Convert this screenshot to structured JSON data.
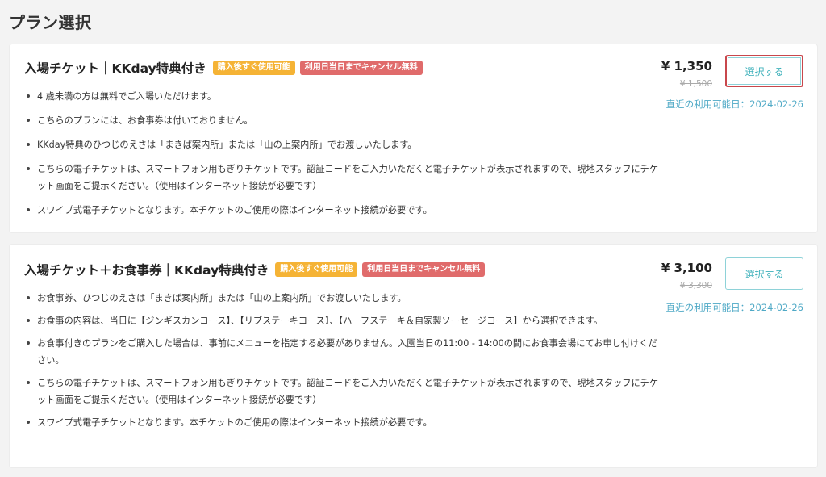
{
  "page": {
    "title": "プラン選択"
  },
  "plans": [
    {
      "name": "入場チケット｜KKday特典付き",
      "tags": [
        "購入後すぐ使用可能",
        "利用日当日までキャンセル無料"
      ],
      "price": "¥ 1,350",
      "original_price": "¥ 1,500",
      "availability": "直近の利用可能日：2024-02-26",
      "select_label": "選択する",
      "features": [
        "4 歳未満の方は無料でご入場いただけます。",
        "こちらのプランには、お食事券は付いておりません。",
        "KKday特典のひつじのえさは「まきば案内所」または「山の上案内所」でお渡しいたします。",
        "こちらの電子チケットは、スマートフォン用もぎりチケットです。認証コードをご入力いただくと電子チケットが表示されますので、現地スタッフにチケット画面をご提示ください。（使用はインターネット接続が必要です）",
        "スワイプ式電子チケットとなります。本チケットのご使用の際はインターネット接続が必要です。"
      ]
    },
    {
      "name": "入場チケット＋お食事券｜KKday特典付き",
      "tags": [
        "購入後すぐ使用可能",
        "利用日当日までキャンセル無料"
      ],
      "price": "¥ 3,100",
      "original_price": "¥ 3,300",
      "availability": "直近の利用可能日：2024-02-26",
      "select_label": "選択する",
      "features": [
        "お食事券、ひつじのえさは「まきば案内所」または「山の上案内所」でお渡しいたします。",
        "お食事の内容は、当日に【ジンギスカンコース】、【リブステーキコース】、【ハーフステーキ＆自家製ソーセージコース】から選択できます。",
        "お食事付きのプランをご購入した場合は、事前にメニューを指定する必要がありません。入園当日の11:00 - 14:00の間にお食事会場にてお申し付けください。",
        "こちらの電子チケットは、スマートフォン用もぎりチケットです。認証コードをご入力いただくと電子チケットが表示されますので、現地スタッフにチケット画面をご提示ください。（使用はインターネット接続が必要です）",
        "スワイプ式電子チケットとなります。本チケットのご使用の際はインターネット接続が必要です。"
      ]
    }
  ],
  "colors": {
    "accent_teal": "#3cb0ba",
    "availability_blue": "#4fa9c6",
    "tag_yellow": "#f5b335",
    "tag_red": "#e06b6b",
    "highlight_red": "#c8474c"
  }
}
